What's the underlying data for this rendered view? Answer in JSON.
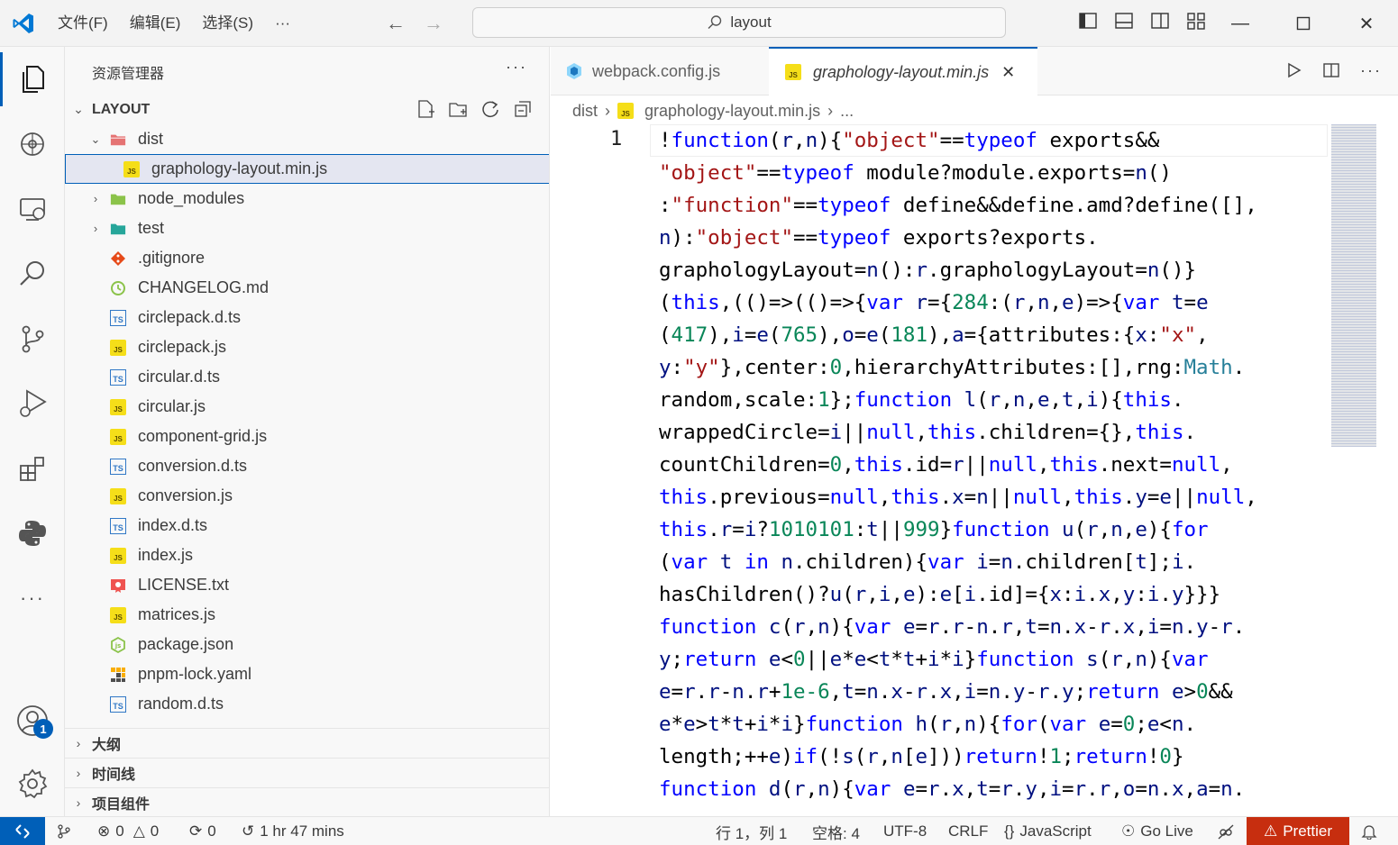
{
  "titlebar": {
    "menu": [
      "文件(F)",
      "编辑(E)",
      "选择(S)",
      "···"
    ],
    "search_text": "layout"
  },
  "activitybar": {
    "items": [
      "explorer-icon",
      "remote-explorer-icon",
      "search-icon",
      "source-control-icon",
      "run-debug-icon",
      "extensions-icon",
      "python-icon",
      "more-icon",
      "account-icon",
      "settings-gear-icon"
    ],
    "account_badge": "1"
  },
  "sidebar": {
    "title": "资源管理器",
    "more": "···",
    "root_section": "LAYOUT",
    "tree": [
      {
        "name": "dist",
        "type": "folder-open",
        "depth": 1
      },
      {
        "name": "graphology-layout.min.js",
        "type": "js",
        "depth": 2,
        "selected": true
      },
      {
        "name": "node_modules",
        "type": "folder",
        "depth": 1
      },
      {
        "name": "test",
        "type": "folder",
        "depth": 1
      },
      {
        "name": ".gitignore",
        "type": "git",
        "depth": 1
      },
      {
        "name": "CHANGELOG.md",
        "type": "changelog",
        "depth": 1
      },
      {
        "name": "circlepack.d.ts",
        "type": "ts",
        "depth": 1
      },
      {
        "name": "circlepack.js",
        "type": "js",
        "depth": 1
      },
      {
        "name": "circular.d.ts",
        "type": "ts",
        "depth": 1
      },
      {
        "name": "circular.js",
        "type": "js",
        "depth": 1
      },
      {
        "name": "component-grid.js",
        "type": "js",
        "depth": 1
      },
      {
        "name": "conversion.d.ts",
        "type": "ts",
        "depth": 1
      },
      {
        "name": "conversion.js",
        "type": "js",
        "depth": 1
      },
      {
        "name": "index.d.ts",
        "type": "ts",
        "depth": 1
      },
      {
        "name": "index.js",
        "type": "js",
        "depth": 1
      },
      {
        "name": "LICENSE.txt",
        "type": "license",
        "depth": 1
      },
      {
        "name": "matrices.js",
        "type": "js",
        "depth": 1
      },
      {
        "name": "package.json",
        "type": "json",
        "depth": 1
      },
      {
        "name": "pnpm-lock.yaml",
        "type": "yaml",
        "depth": 1
      },
      {
        "name": "random.d.ts",
        "type": "ts",
        "depth": 1
      }
    ],
    "sections": [
      "大纲",
      "时间线",
      "项目组件"
    ]
  },
  "editor": {
    "tabs": [
      {
        "label": "webpack.config.js",
        "active": false
      },
      {
        "label": "graphology-layout.min.js",
        "active": true
      }
    ],
    "breadcrumb": [
      "dist",
      "graphology-layout.min.js",
      "..."
    ],
    "line_number": "1",
    "code_lines": [
      "!function(r,n){\"object\"==typeof exports&&",
      "\"object\"==typeof module?module.exports=n()",
      ":\"function\"==typeof define&&define.amd?define([],",
      "n):\"object\"==typeof exports?exports.",
      "graphologyLayout=n():r.graphologyLayout=n()}",
      "(this,(()=>(()=>{var r={284:(r,n,e)=>{var t=e",
      "(417),i=e(765),o=e(181),a={attributes:{x:\"x\",",
      "y:\"y\"},center:0,hierarchyAttributes:[],rng:Math.",
      "random,scale:1};function l(r,n,e,t,i){this.",
      "wrappedCircle=i||null,this.children={},this.",
      "countChildren=0,this.id=r||null,this.next=null,",
      "this.previous=null,this.x=n||null,this.y=e||null,",
      "this.r=i?1010101:t||999}function u(r,n,e){for",
      "(var t in n.children){var i=n.children[t];i.",
      "hasChildren()?u(r,i,e):e[i.id]={x:i.x,y:i.y}}}",
      "function c(r,n){var e=r.r-n.r,t=n.x-r.x,i=n.y-r.",
      "y;return e<0||e*e<t*t+i*i}function s(r,n){var",
      "e=r.r-n.r+1e-6,t=n.x-r.x,i=n.y-r.y;return e>0&&",
      "e*e>t*t+i*i}function h(r,n){for(var e=0;e<n.",
      "length;++e)if(!s(r,n[e]))return!1;return!0}",
      "function d(r,n){var e=r.x,t=r.y,i=r.r,o=n.x,a=n."
    ]
  },
  "statusbar": {
    "problems_errors": "0",
    "problems_warnings": "0",
    "ports": "0",
    "time": "1 hr 47 mins",
    "position": "行 1，列 1",
    "spaces": "空格: 4",
    "encoding": "UTF-8",
    "eol": "CRLF",
    "language": "JavaScript",
    "golive": "Go Live",
    "prettier": "Prettier"
  },
  "colors": {
    "accent": "#005fb8",
    "prettier_bg": "#c72e0f",
    "js_icon": "#f5de19",
    "ts_icon": "#3178c6"
  }
}
